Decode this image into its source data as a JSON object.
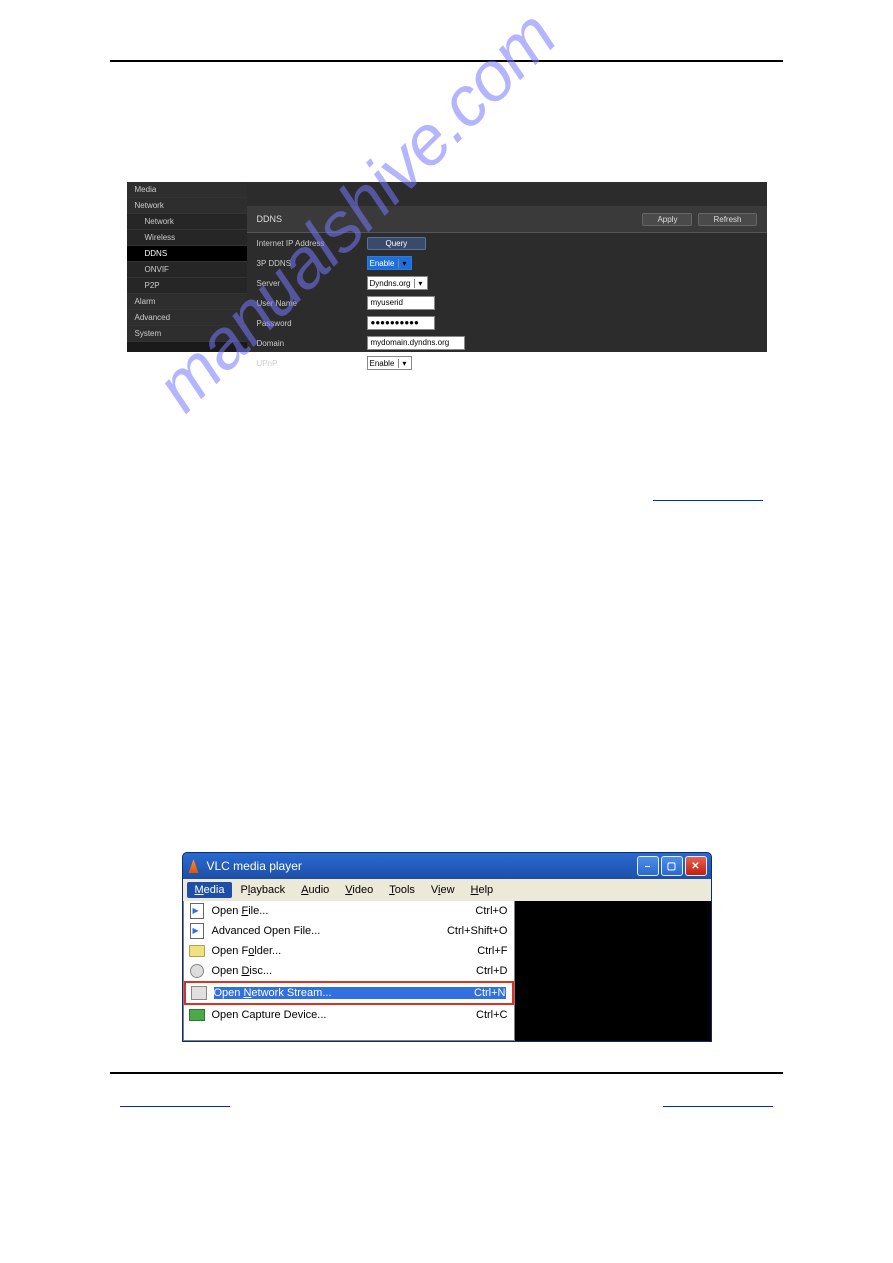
{
  "watermark": "manualshive.com",
  "ddns_panel": {
    "sidebar": {
      "items": [
        {
          "label": "Media"
        },
        {
          "label": "Network"
        },
        {
          "label": "Network",
          "sub": true
        },
        {
          "label": "Wireless",
          "sub": true
        },
        {
          "label": "DDNS",
          "sub": true,
          "active": true
        },
        {
          "label": "ONVIF",
          "sub": true
        },
        {
          "label": "P2P",
          "sub": true
        },
        {
          "label": "Alarm"
        },
        {
          "label": "Advanced"
        },
        {
          "label": "System"
        }
      ]
    },
    "title": "DDNS",
    "apply_label": "Apply",
    "refresh_label": "Refresh",
    "rows": {
      "ip_label": "Internet IP Address",
      "query_label": "Query",
      "ddns3p_label": "3P DDNS",
      "ddns3p_value": "Enable",
      "server_label": "Server",
      "server_value": "Dyndns.org",
      "user_label": "User Name",
      "user_value": "myuserid",
      "pass_label": "Password",
      "pass_value": "●●●●●●●●●●",
      "domain_label": "Domain",
      "domain_value": "mydomain.dyndns.org",
      "upnp_label": "UPnP",
      "upnp_value": "Enable"
    }
  },
  "vlc": {
    "title": "VLC media player",
    "menus": {
      "media": "Media",
      "playback": "Playback",
      "audio": "Audio",
      "video": "Video",
      "tools": "Tools",
      "view": "View",
      "help": "Help"
    },
    "items": [
      {
        "label": "Open File...",
        "shortcut": "Ctrl+O",
        "icon": "file",
        "ukey": "F"
      },
      {
        "label": "Advanced Open File...",
        "shortcut": "Ctrl+Shift+O",
        "icon": "file"
      },
      {
        "label": "Open Folder...",
        "shortcut": "Ctrl+F",
        "icon": "folder",
        "ukey": "F"
      },
      {
        "label": "Open Disc...",
        "shortcut": "Ctrl+D",
        "icon": "disc",
        "ukey": "D"
      },
      {
        "label": "Open Network Stream...",
        "shortcut": "Ctrl+N",
        "icon": "net",
        "highlight": true,
        "ukey": "N"
      },
      {
        "label": "Open Capture Device...",
        "shortcut": "Ctrl+C",
        "icon": "cap"
      }
    ]
  }
}
